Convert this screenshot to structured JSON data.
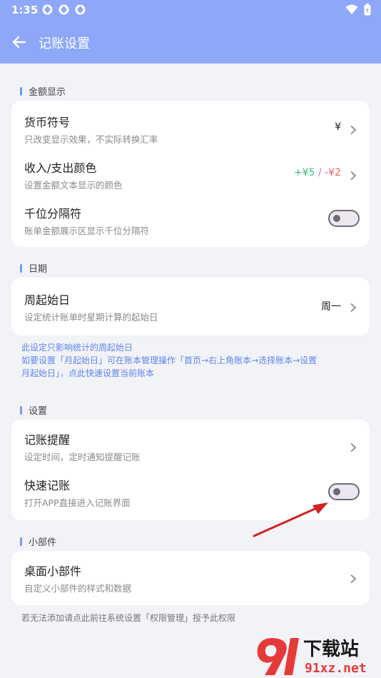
{
  "status": {
    "time": "1:35"
  },
  "header": {
    "title": "记账设置"
  },
  "sections": {
    "amount": {
      "title": "金额显示",
      "currency": {
        "title": "货币符号",
        "desc": "只改变显示效果，不实际转换汇率",
        "value": "¥"
      },
      "colors": {
        "title": "收入/支出颜色",
        "desc": "设置金额文本显示的颜色",
        "income": "+¥5",
        "sep": " / ",
        "expense": "-¥2",
        "income_color": "#3dbb80",
        "expense_color": "#ee5f6a"
      },
      "separator": {
        "title": "千位分隔符",
        "desc": "账单金额展示区显示千位分隔符",
        "enabled": false
      }
    },
    "date": {
      "title": "日期",
      "week_start": {
        "title": "周起始日",
        "desc": "设定统计账单时星期计算的起始日",
        "value": "周一"
      },
      "note_line1": "此设定只影响统计的周起始日",
      "note_line2": "如要设置「月起始日」可在账本管理操作「首页→右上角账本→选择账本→设置",
      "note_line3": "月起始日」，点此快速设置当前账本"
    },
    "settings": {
      "title": "设置",
      "reminder": {
        "title": "记账提醒",
        "desc": "设定时间，定时通知提醒记账"
      },
      "quick": {
        "title": "快速记账",
        "desc": "打开APP直接进入记账界面",
        "enabled": false
      }
    },
    "widget": {
      "title": "小部件",
      "desktop": {
        "title": "桌面小部件",
        "desc": "自定义小部件的样式和数据"
      },
      "note": "若无法添加请点此前往系统设置「权限管理」授予此权限"
    }
  },
  "watermark": {
    "brand": "下载站",
    "site": "91xz.net"
  },
  "colors": {
    "accent": "#8ea7f8",
    "link": "#5f85f0"
  }
}
